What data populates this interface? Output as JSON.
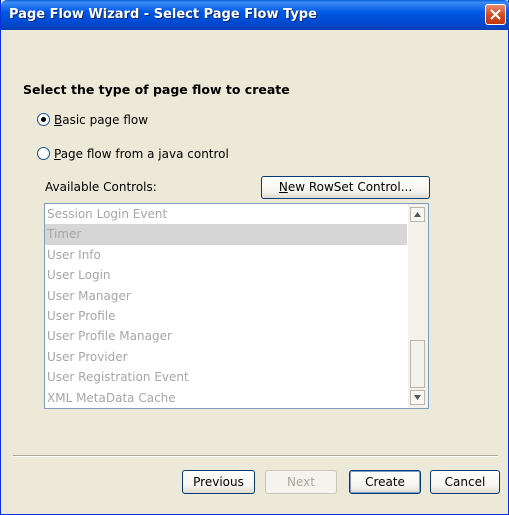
{
  "window": {
    "title": "Page Flow Wizard - Select Page Flow Type"
  },
  "heading": "Select the type of page flow to create",
  "options": [
    {
      "mnemonic": "B",
      "rest": "asic page flow",
      "selected": true
    },
    {
      "mnemonic": "P",
      "rest": "age flow from a java control",
      "selected": false
    }
  ],
  "available_controls_label": "Available Controls:",
  "new_rowset": {
    "mnemonic": "N",
    "rest": "ew RowSet Control..."
  },
  "controls": [
    "Session Login Event",
    "Timer",
    "User Info",
    "User Login",
    "User Manager",
    "User Profile",
    "User Profile Manager",
    "User Provider",
    "User Registration Event",
    "XML MetaData Cache"
  ],
  "selected_control": "Timer",
  "buttons": {
    "previous": "Previous",
    "next": "Next",
    "create": "Create",
    "cancel": "Cancel"
  },
  "icons": {
    "close": "close-icon",
    "scroll_up": "scroll-up-icon",
    "scroll_down": "scroll-down-icon"
  },
  "colors": {
    "titlebar": "#0058e6",
    "close": "#d2471d",
    "disabled_text": "#a6a6a6"
  }
}
